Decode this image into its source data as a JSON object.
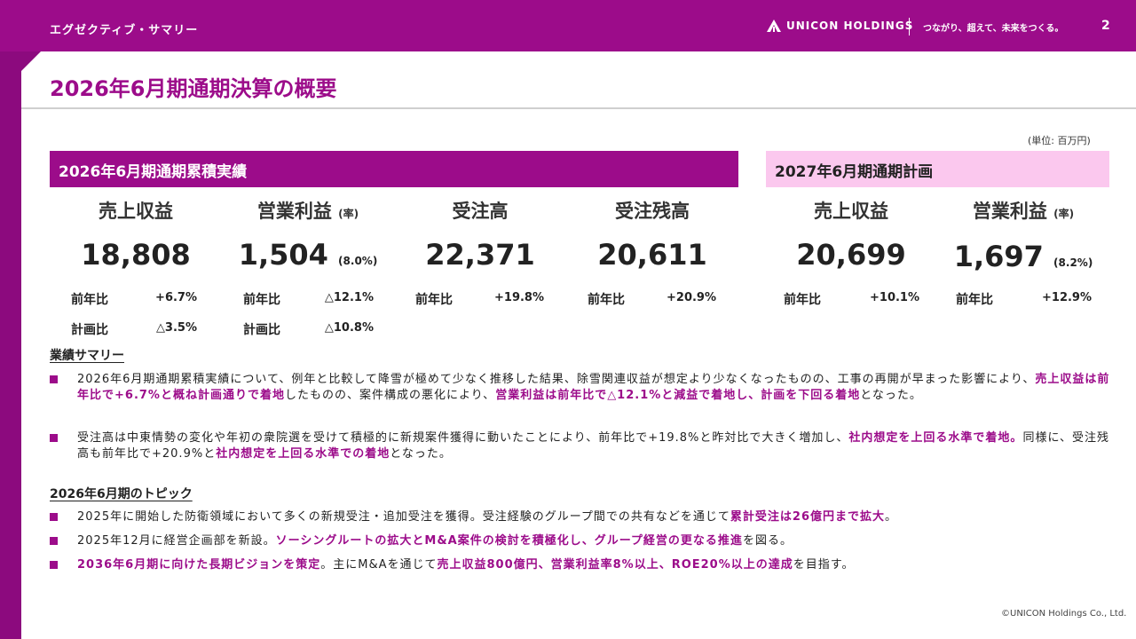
{
  "header": {
    "section_label": "エグゼクティブ・サマリー",
    "brand_name": "UNICON HOLDINGS",
    "tagline": "つながり、超えて、未来をつくる。",
    "page_number": "2"
  },
  "page": {
    "title": "2026年6月期通期決算の概要",
    "unit_note": "(単位: 百万円)"
  },
  "results": {
    "banner": "2026年6月期通期累積実績",
    "metrics": [
      {
        "label": "売上収益",
        "label_suffix": "",
        "value": "18,808",
        "value_suffix": "",
        "rows": [
          {
            "label": "前年比",
            "value": "+6.7%"
          },
          {
            "label": "計画比",
            "value": "△3.5%"
          }
        ]
      },
      {
        "label": "営業利益",
        "label_suffix": "(率)",
        "value": "1,504",
        "value_suffix": "(8.0%)",
        "rows": [
          {
            "label": "前年比",
            "value": "△12.1%"
          },
          {
            "label": "計画比",
            "value": "△10.8%"
          }
        ]
      },
      {
        "label": "受注高",
        "label_suffix": "",
        "value": "22,371",
        "value_suffix": "",
        "rows": [
          {
            "label": "前年比",
            "value": "+19.8%"
          }
        ]
      },
      {
        "label": "受注残高",
        "label_suffix": "",
        "value": "20,611",
        "value_suffix": "",
        "rows": [
          {
            "label": "前年比",
            "value": "+20.9%"
          }
        ]
      }
    ]
  },
  "plan": {
    "banner": "2027年6月期通期計画",
    "metrics": [
      {
        "label": "売上収益",
        "label_suffix": "",
        "value": "20,699",
        "value_suffix": "",
        "rows": [
          {
            "label": "前年比",
            "value": "+10.1%"
          }
        ]
      },
      {
        "label": "営業利益",
        "label_suffix": "(率)",
        "value": "1,697",
        "value_suffix": "(8.2%)",
        "rows": [
          {
            "label": "前年比",
            "value": "+12.9%"
          }
        ]
      }
    ]
  },
  "summary": {
    "heading": "業績サマリー",
    "bullets": [
      {
        "s1": "2026年6月期通期累積実績について、例年と比較して降雪が極めて少なく推移した結果、除雪関連収益が想定より少なくなったものの、工事の再開が早まった影響により、",
        "h1": "売上収益は前年比で+6.7%と概ね計画通りで着地",
        "s2": "したものの、案件構成の悪化により、",
        "h2": "営業利益は前年比で△12.1%と減益で着地し、計画を下回る着地",
        "s3": "となった。"
      },
      {
        "s1": "受注高は中東情勢の変化や年初の衆院選を受けて積極的に新規案件獲得に動いたことにより、前年比で+19.8%と昨対比で大きく増加し、",
        "h1": "社内想定を上回る水準で着地。",
        "s2": "同様に、受注残高も前年比で+20.9%と",
        "h2": "社内想定を上回る水準での着地",
        "s3": "となった。"
      }
    ]
  },
  "topics": {
    "heading": "2026年6月期のトピック",
    "bullets": [
      {
        "s0": "",
        "h0": "",
        "s1": "2025年に開始した防衛領域において多くの新規受注・追加受注を獲得。受注経験のグループ間での共有などを通じて",
        "h1": "累計受注は26億円まで拡大",
        "s2": "。",
        "h2": "",
        "s3": ""
      },
      {
        "s0": "",
        "h0": "",
        "s1": "2025年12月に経営企画部を新設。",
        "h1": "ソーシングルートの拡大とM&A案件の検討を積極化し、グループ経営の更なる推進",
        "s2": "を図る。",
        "h2": "",
        "s3": ""
      },
      {
        "s0": "",
        "h0": "2036年6月期に向けた長期ビジョンを策定",
        "s1": "。主にM&Aを通じて",
        "h1": "売上収益800億円、営業利益率8%以上、ROE20%以上の達成",
        "s2": "を目指す。",
        "h2": "",
        "s3": ""
      }
    ]
  },
  "footer": {
    "copyright": "©UNICON Holdings Co., Ltd."
  }
}
